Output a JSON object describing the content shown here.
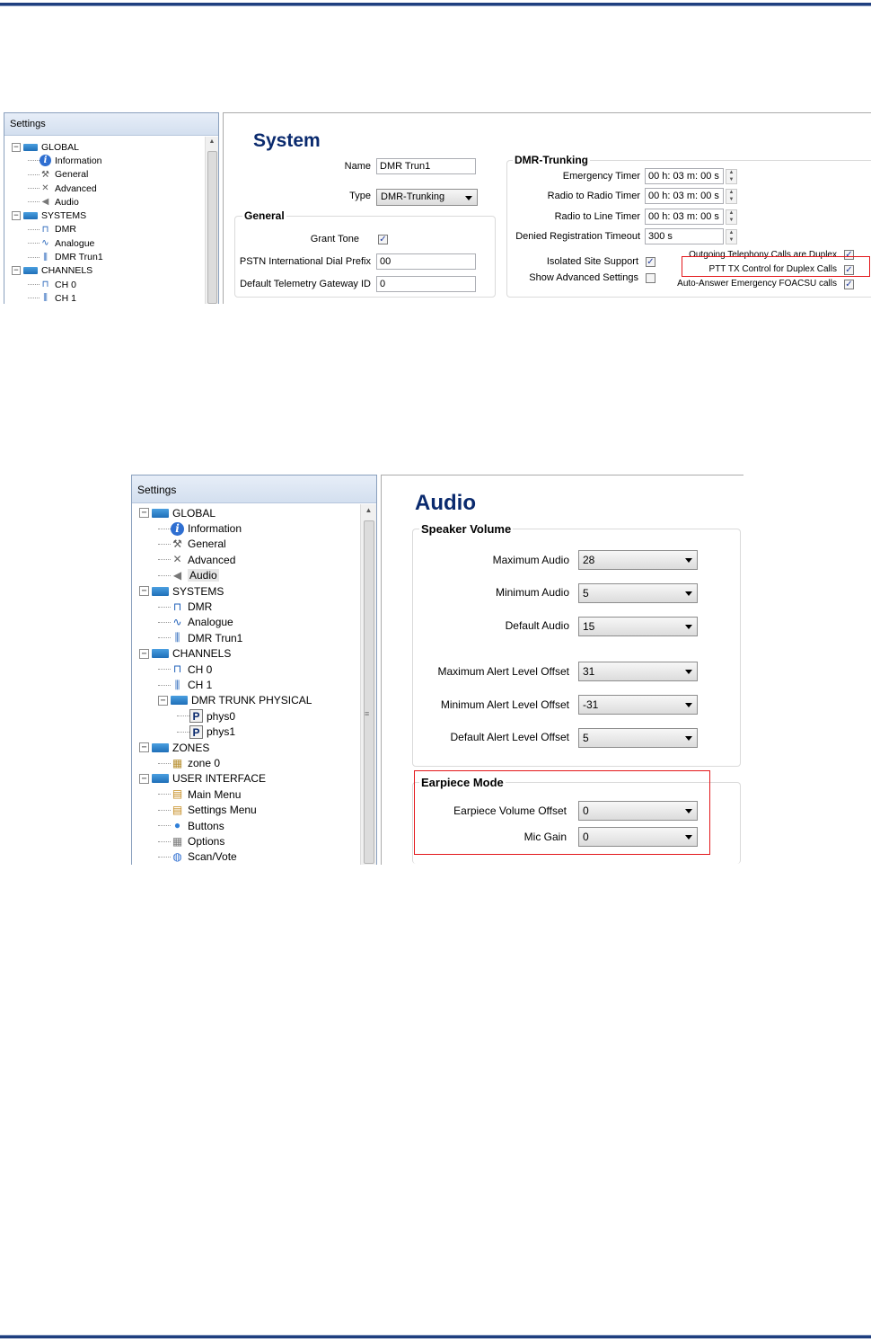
{
  "top_screenshot": {
    "tree": {
      "header": "Settings",
      "nodes": [
        {
          "label": "GLOBAL",
          "level": 0,
          "icon": "folder-icon",
          "expander": "−"
        },
        {
          "label": "Information",
          "level": 1,
          "icon": "info-icon"
        },
        {
          "label": "General",
          "level": 1,
          "icon": "wrench-icon"
        },
        {
          "label": "Advanced",
          "level": 1,
          "icon": "tools-icon"
        },
        {
          "label": "Audio",
          "level": 1,
          "icon": "speaker-icon"
        },
        {
          "label": "SYSTEMS",
          "level": 0,
          "icon": "folder-icon",
          "expander": "−"
        },
        {
          "label": "DMR",
          "level": 1,
          "icon": "pulse-icon"
        },
        {
          "label": "Analogue",
          "level": 1,
          "icon": "wave-icon"
        },
        {
          "label": "DMR Trun1",
          "level": 1,
          "icon": "trunk-icon"
        },
        {
          "label": "CHANNELS",
          "level": 0,
          "icon": "folder-icon",
          "expander": "−"
        },
        {
          "label": "CH 0",
          "level": 1,
          "icon": "pulse-icon"
        },
        {
          "label": "CH 1",
          "level": 1,
          "icon": "trunk-icon"
        }
      ]
    },
    "panel": {
      "title": "System",
      "name_label": "Name",
      "name_value": "DMR Trun1",
      "type_label": "Type",
      "type_value": "DMR-Trunking",
      "general": {
        "title": "General",
        "grant_tone_label": "Grant Tone",
        "grant_tone_checked": true,
        "pstn_label": "PSTN International Dial Prefix",
        "pstn_value": "00",
        "gateway_label": "Default Telemetry Gateway ID",
        "gateway_value": "0"
      },
      "dmr_trunking": {
        "title": "DMR-Trunking",
        "emergency_label": "Emergency Timer",
        "emergency_value": "00 h: 03 m: 00 s",
        "r2r_label": "Radio to Radio Timer",
        "r2r_value": "00 h: 03 m: 00 s",
        "r2l_label": "Radio to Line Timer",
        "r2l_value": "00 h: 03 m: 00 s",
        "denied_label": "Denied Registration Timeout",
        "denied_value": "300 s",
        "isolated_label": "Isolated Site Support",
        "isolated_checked": true,
        "show_adv_label": "Show Advanced Settings",
        "show_adv_checked": false,
        "outgoing_label": "Outgoing Telephony Calls are Duplex",
        "outgoing_checked": true,
        "ptt_label": "PTT TX Control for Duplex Calls",
        "ptt_checked": true,
        "auto_answer_label": "Auto-Answer Emergency FOACSU calls",
        "auto_answer_checked": true
      }
    }
  },
  "bottom_screenshot": {
    "tree": {
      "header": "Settings",
      "nodes": [
        {
          "label": "GLOBAL",
          "level": 0,
          "icon": "folder-icon",
          "expander": "−"
        },
        {
          "label": "Information",
          "level": 1,
          "icon": "info-icon"
        },
        {
          "label": "General",
          "level": 1,
          "icon": "wrench-icon"
        },
        {
          "label": "Advanced",
          "level": 1,
          "icon": "tools-icon"
        },
        {
          "label": "Audio",
          "level": 1,
          "icon": "speaker-icon",
          "selected": true
        },
        {
          "label": "SYSTEMS",
          "level": 0,
          "icon": "folder-icon",
          "expander": "−"
        },
        {
          "label": "DMR",
          "level": 1,
          "icon": "pulse-icon"
        },
        {
          "label": "Analogue",
          "level": 1,
          "icon": "wave-icon"
        },
        {
          "label": "DMR Trun1",
          "level": 1,
          "icon": "trunk-icon"
        },
        {
          "label": "CHANNELS",
          "level": 0,
          "icon": "folder-icon",
          "expander": "−"
        },
        {
          "label": "CH 0",
          "level": 1,
          "icon": "pulse-icon"
        },
        {
          "label": "CH 1",
          "level": 1,
          "icon": "trunk-icon"
        },
        {
          "label": "DMR TRUNK PHYSICAL",
          "level": 1,
          "icon": "folder-icon",
          "expander": "−"
        },
        {
          "label": "phys0",
          "level": 2,
          "icon": "p-icon"
        },
        {
          "label": "phys1",
          "level": 2,
          "icon": "p-icon"
        },
        {
          "label": "ZONES",
          "level": 0,
          "icon": "folder-icon",
          "expander": "−"
        },
        {
          "label": "zone 0",
          "level": 1,
          "icon": "zone-icon"
        },
        {
          "label": "USER INTERFACE",
          "level": 0,
          "icon": "folder-icon",
          "expander": "−"
        },
        {
          "label": "Main Menu",
          "level": 1,
          "icon": "menu-icon"
        },
        {
          "label": "Settings Menu",
          "level": 1,
          "icon": "menu-icon"
        },
        {
          "label": "Buttons",
          "level": 1,
          "icon": "button-icon"
        },
        {
          "label": "Options",
          "level": 1,
          "icon": "options-icon"
        },
        {
          "label": "Scan/Vote",
          "level": 1,
          "icon": "scan-icon"
        }
      ]
    },
    "panel": {
      "title": "Audio",
      "speaker": {
        "title": "Speaker Volume",
        "max_audio_label": "Maximum Audio",
        "max_audio_value": "28",
        "min_audio_label": "Minimum Audio",
        "min_audio_value": "5",
        "def_audio_label": "Default Audio",
        "def_audio_value": "15",
        "max_alert_label": "Maximum Alert Level Offset",
        "max_alert_value": "31",
        "min_alert_label": "Minimum Alert Level Offset",
        "min_alert_value": "-31",
        "def_alert_label": "Default Alert Level Offset",
        "def_alert_value": "5"
      },
      "earpiece": {
        "title": "Earpiece Mode",
        "vol_offset_label": "Earpiece Volume Offset",
        "vol_offset_value": "0",
        "mic_gain_label": "Mic Gain",
        "mic_gain_value": "0"
      }
    }
  },
  "colors": {
    "accent_title": "#0a2a6e",
    "highlight_red": "#e3171b",
    "rule_blue": "#1f3f7f"
  }
}
